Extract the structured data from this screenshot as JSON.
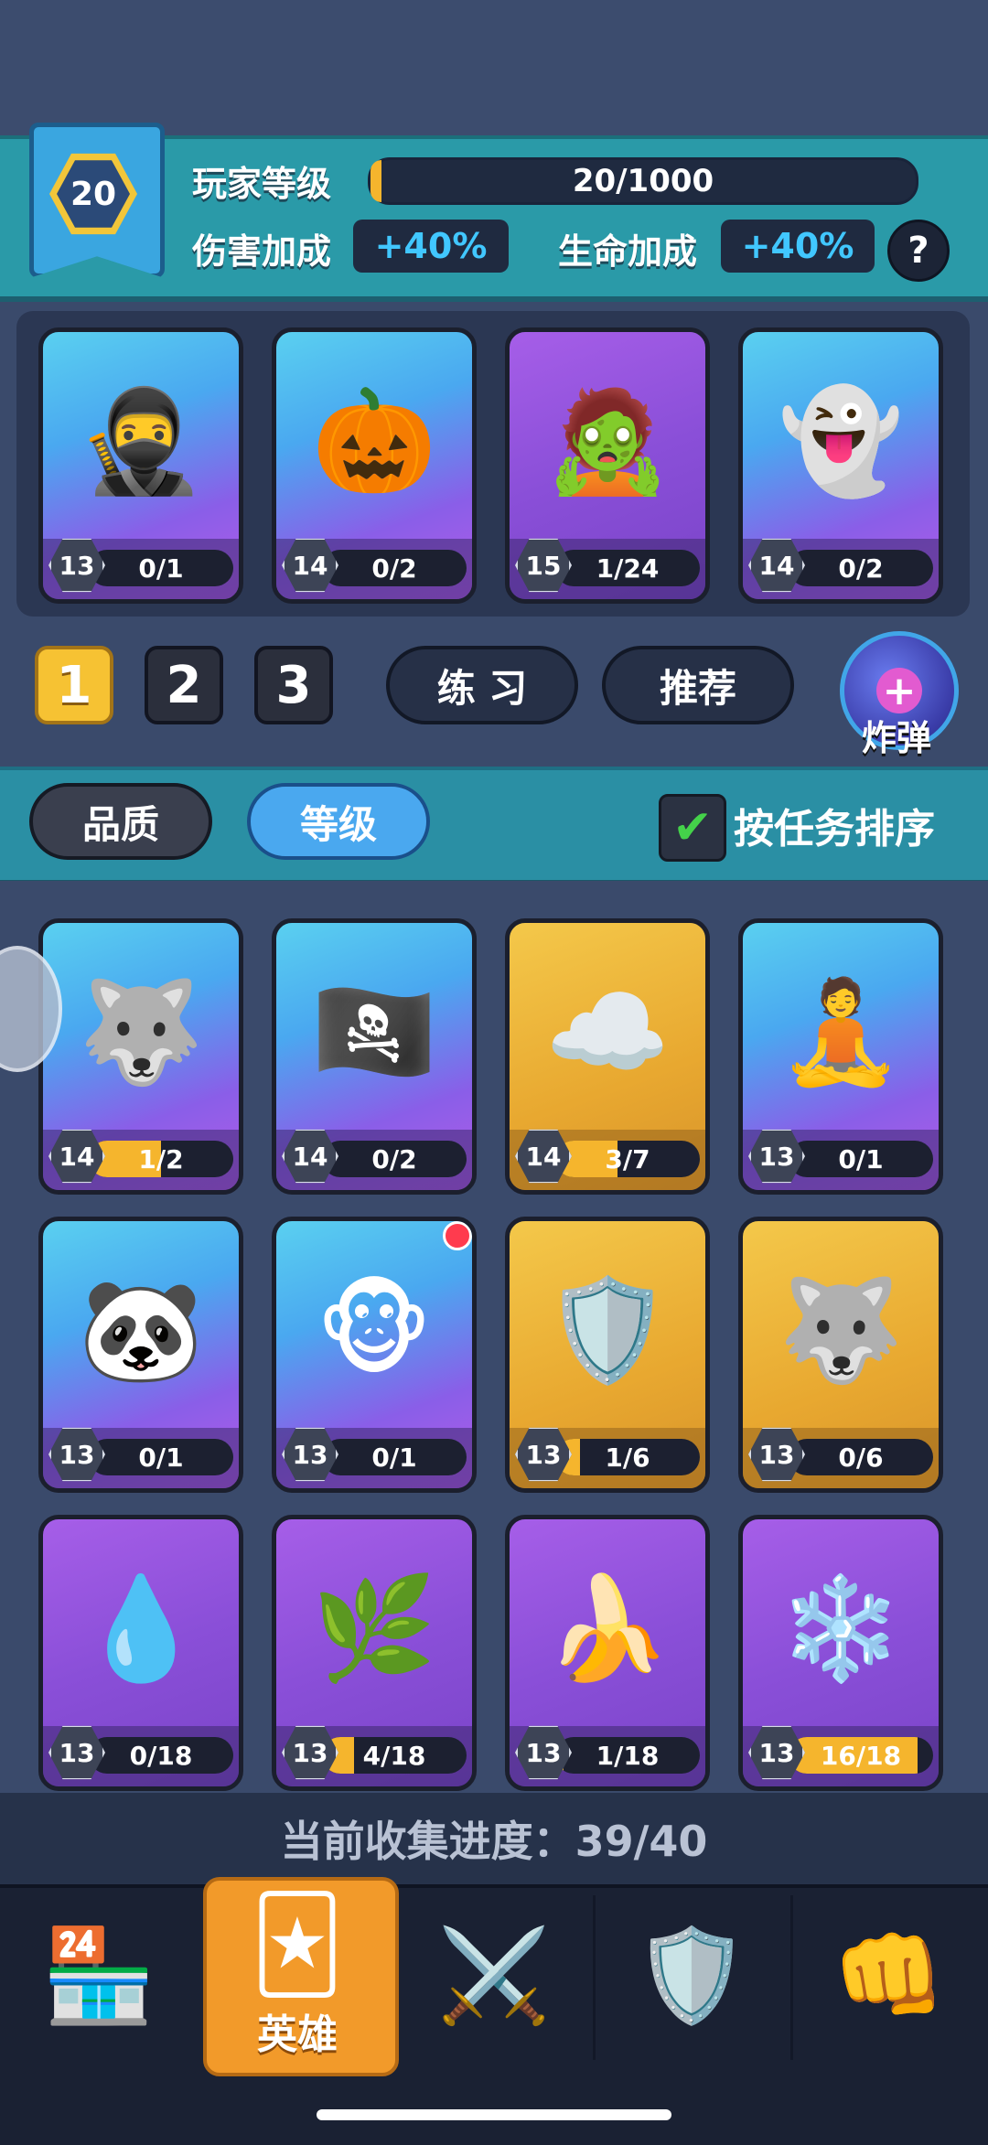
{
  "header": {
    "level": "20",
    "player_level_label": "玩家等级",
    "xp_text": "20/1000",
    "xp_progress": 0.02,
    "damage_label": "伤害加成",
    "damage_value": "+40%",
    "health_label": "生命加成",
    "health_value": "+40%",
    "help_icon": "?"
  },
  "deck": {
    "cards": [
      {
        "icon": "samurai-hero",
        "glyph": "🥷",
        "style": "blue",
        "level": "13",
        "progress": "0/1",
        "fill": 0
      },
      {
        "icon": "pumpkin-gentleman-hero",
        "glyph": "🎃",
        "style": "blue",
        "level": "14",
        "progress": "0/2",
        "fill": 0
      },
      {
        "icon": "frankenstein-hook-hero",
        "glyph": "🧟",
        "style": "purple",
        "level": "15",
        "progress": "1/24",
        "fill": 0.04
      },
      {
        "icon": "ghost-knight-hero",
        "glyph": "👻",
        "style": "blue",
        "level": "14",
        "progress": "0/2",
        "fill": 0
      }
    ],
    "tabs": [
      "1",
      "2",
      "3"
    ],
    "active_tab": "1",
    "practice_label": "练 习",
    "recommend_label": "推荐",
    "bomb_label": "炸弹"
  },
  "sort": {
    "quality_label": "品质",
    "level_label": "等级",
    "task_sort_label": "按任务排序",
    "task_sort_checked": true
  },
  "collection": {
    "cards": [
      {
        "icon": "anubis-hero",
        "glyph": "🐺",
        "style": "blue",
        "level": "14",
        "progress": "1/2",
        "fill": 0.5
      },
      {
        "icon": "pirate-captain-hero",
        "glyph": "🏴‍☠️",
        "style": "blue",
        "level": "14",
        "progress": "0/2",
        "fill": 0
      },
      {
        "icon": "cloud-spirit-hero",
        "glyph": "☁️",
        "style": "gold",
        "level": "14",
        "progress": "3/7",
        "fill": 0.43
      },
      {
        "icon": "monk-hero",
        "glyph": "🧘",
        "style": "blue",
        "level": "13",
        "progress": "0/1",
        "fill": 0
      },
      {
        "icon": "panda-hero",
        "glyph": "🐼",
        "style": "blue",
        "level": "13",
        "progress": "0/1",
        "fill": 0
      },
      {
        "icon": "monkey-king-hero",
        "glyph": "🐵",
        "style": "blue",
        "level": "13",
        "progress": "0/1",
        "fill": 0,
        "badge": true
      },
      {
        "icon": "knight-hero",
        "glyph": "🛡️",
        "style": "gold",
        "level": "13",
        "progress": "1/6",
        "fill": 0.17
      },
      {
        "icon": "werewolf-hero",
        "glyph": "🐺",
        "style": "gold",
        "level": "13",
        "progress": "0/6",
        "fill": 0
      },
      {
        "icon": "slime-blob-hero",
        "glyph": "💧",
        "style": "purple",
        "level": "13",
        "progress": "0/18",
        "fill": 0
      },
      {
        "icon": "forest-sprite-hero",
        "glyph": "🌿",
        "style": "purple",
        "level": "13",
        "progress": "4/18",
        "fill": 0.22
      },
      {
        "icon": "banana-brute-hero",
        "glyph": "🍌",
        "style": "purple",
        "level": "13",
        "progress": "1/18",
        "fill": 0.06
      },
      {
        "icon": "ice-princess-hero",
        "glyph": "❄️",
        "style": "purple",
        "level": "13",
        "progress": "16/18",
        "fill": 0.89
      }
    ],
    "progress_text": "当前收集进度：39/40"
  },
  "nav": {
    "shop_icon": "shop-icon",
    "heroes_label": "英雄",
    "battle_icon": "crossed-swords-icon",
    "clan_icon": "shield-crest-icon",
    "events_icon": "fist-gauntlet-icon"
  }
}
